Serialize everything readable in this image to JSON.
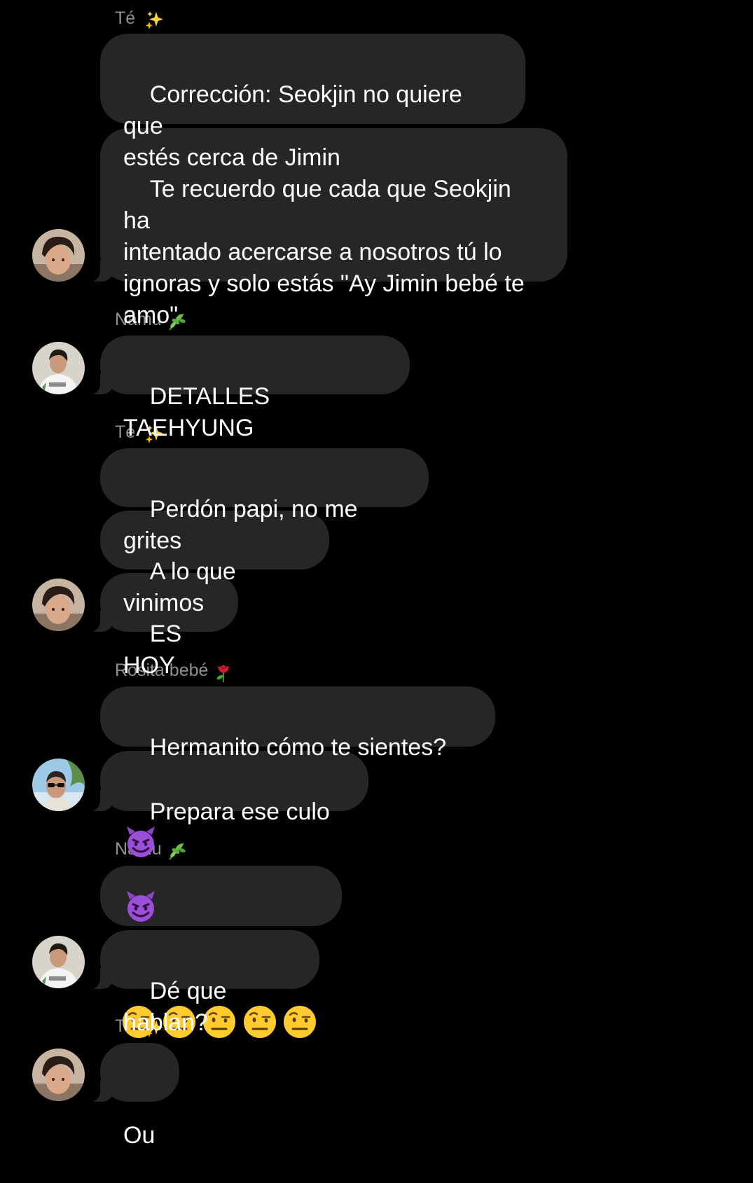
{
  "messages": [
    {
      "sender": "Té",
      "sender_emoji": "sparkles-icon",
      "text": "Corrección: Seokjin no quiere que\nestés cerca de Jimin"
    },
    {
      "text": "Te recuerdo que cada que Seokjin ha\nintentado acercarse a nosotros tú lo\nignoras y solo estás \"Ay Jimin bebé te\namo\"",
      "avatar": "avatar-te-icon"
    },
    {
      "sender": "Namu",
      "sender_emoji": "herb-icon",
      "text": "DETALLES TAEHYUNG",
      "avatar": "avatar-namu-icon"
    },
    {
      "sender": "Té",
      "sender_emoji": "sparkles-icon",
      "text": "Perdón papi, no me grites"
    },
    {
      "text": "A lo que vinimos"
    },
    {
      "text": "ES HOY",
      "avatar": "avatar-te-icon"
    },
    {
      "sender": "Rosita bebé",
      "sender_emoji": "rose-icon",
      "text": "Hermanito cómo te sientes?",
      "trailing_emoji": "smiling-devil-icon"
    },
    {
      "text": "Prepara ese culo",
      "trailing_emoji": "smiling-devil-icon",
      "avatar": "avatar-rosita-icon"
    },
    {
      "sender": "Namu",
      "sender_emoji": "herb-icon",
      "emoji_only": "face-with-raised-eyebrow-icon",
      "emoji_count": 5
    },
    {
      "text": "Dé que hablan?",
      "avatar": "avatar-namu-icon"
    },
    {
      "sender": "Té",
      "sender_emoji": "sparkles-icon",
      "text": "Ou",
      "avatar": "avatar-te-icon"
    }
  ],
  "colors": {
    "background": "#000000",
    "bubble": "#262628",
    "text": "#ffffff",
    "sender": "#8e8e93"
  }
}
